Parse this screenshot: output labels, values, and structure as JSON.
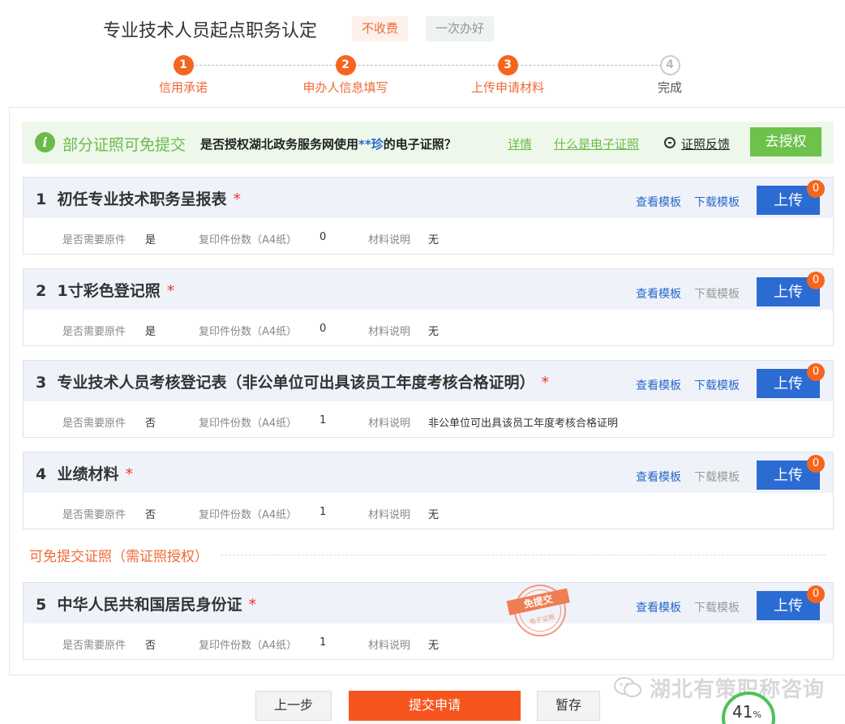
{
  "header": {
    "title": "专业技术人员起点职务认定",
    "tag_free": "不收费",
    "tag_once": "一次办好"
  },
  "steps": [
    {
      "num": "1",
      "label": "信用承诺",
      "done": true
    },
    {
      "num": "2",
      "label": "申办人信息填写",
      "done": true
    },
    {
      "num": "3",
      "label": "上传申请材料",
      "done": true
    },
    {
      "num": "4",
      "label": "完成",
      "done": false
    }
  ],
  "banner": {
    "icon": "i",
    "title": "部分证照可免提交",
    "question_pre": "是否授权湖北政务服务网使用",
    "question_name": "**珍",
    "question_post": "的电子证照？",
    "details_link": "详情",
    "what_link": "什么是电子证照",
    "feedback_link": "证照反馈",
    "authorize_button": "去授权"
  },
  "labels": {
    "original": "是否需要原件",
    "copies": "复印件份数（A4纸）",
    "note": "材料说明",
    "view_template": "查看模板",
    "download_template": "下载模板",
    "upload": "上传",
    "required": "*"
  },
  "materials": [
    {
      "index": "1",
      "name": "初任专业技术职务呈报表",
      "original": "是",
      "copies": "0",
      "note": "无",
      "count": "0",
      "download_enabled": true
    },
    {
      "index": "2",
      "name": "1寸彩色登记照",
      "original": "是",
      "copies": "0",
      "note": "无",
      "count": "0",
      "download_enabled": false
    },
    {
      "index": "3",
      "name": "专业技术人员考核登记表（非公单位可出具该员工年度考核合格证明）",
      "original": "否",
      "copies": "1",
      "note": "非公单位可出具该员工年度考核合格证明",
      "count": "0",
      "download_enabled": true
    },
    {
      "index": "4",
      "name": "业绩材料",
      "original": "否",
      "copies": "1",
      "note": "无",
      "count": "0",
      "download_enabled": false
    },
    {
      "index": "5",
      "name": "中华人民共和国居民身份证",
      "original": "否",
      "copies": "1",
      "note": "无",
      "count": "0",
      "download_enabled": false
    }
  ],
  "exempt_divider": "可免提交证照（需证照授权）",
  "stamp": {
    "text": "免提交",
    "sub": "电子证照"
  },
  "footer": {
    "prev_button": "上一步",
    "submit_button": "提交申请",
    "save_button": "暂存"
  },
  "watermark": "湖北有策职称咨询",
  "progress": {
    "value": "41",
    "unit": "%"
  },
  "colors": {
    "accent_orange": "#f6651e",
    "primary_blue": "#2b6bd2",
    "banner_green": "#6dba4a"
  }
}
